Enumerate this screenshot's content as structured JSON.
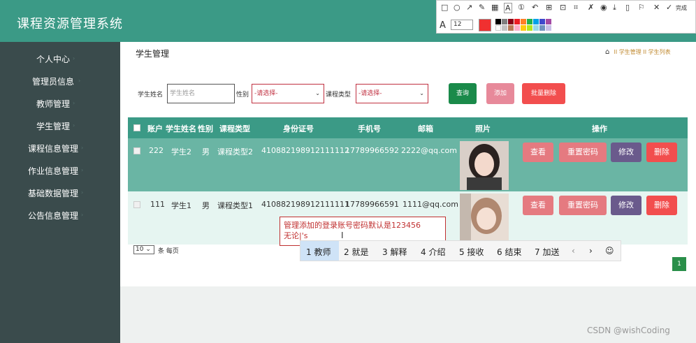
{
  "header": {
    "title": "课程资源管理系统",
    "icon1": "✖",
    "icon2": "♟"
  },
  "sidebar": {
    "items": [
      {
        "label": "个人中心"
      },
      {
        "label": "管理员信息"
      },
      {
        "label": "教师管理"
      },
      {
        "label": "学生管理"
      },
      {
        "label": "课程信息管理"
      },
      {
        "label": "作业信息管理"
      },
      {
        "label": "基础数据管理"
      },
      {
        "label": "公告信息管理"
      }
    ]
  },
  "page": {
    "title": "学生管理",
    "crumb1": "学生管理",
    "crumb2": "学生列表",
    "sep": "II"
  },
  "filters": {
    "name_label": "学生姓名",
    "name_placeholder": "学生姓名",
    "gender_label": "性别",
    "gender_value": "-请选择-",
    "type_label": "课程类型",
    "type_value": "-请选择-"
  },
  "buttons": {
    "search": "查询",
    "add": "添加",
    "batch_delete": "批量删除"
  },
  "table": {
    "headers": [
      "账户",
      "学生姓名",
      "性别",
      "课程类型",
      "身份证号",
      "手机号",
      "邮箱",
      "照片",
      "操作"
    ],
    "rows": [
      {
        "account": "222",
        "name": "学生2",
        "gender": "男",
        "type": "课程类型2",
        "id": "410882198912111112",
        "phone": "17789966592",
        "email": "2222@qq.com"
      },
      {
        "account": "111",
        "name": "学生1",
        "gender": "男",
        "type": "课程类型1",
        "id": "410882198912111111",
        "phone": "17789966591",
        "email": "1111@qq.com"
      }
    ],
    "actions": {
      "view": "查看",
      "reset": "重置密码",
      "edit": "修改",
      "delete": "删除"
    }
  },
  "pagination": {
    "per_page": "10",
    "per_page_label": "条 每页",
    "current": "1"
  },
  "tooltip": {
    "line1": "管理添加的登录账号密码默认是123456",
    "line2": "无论|'s"
  },
  "ime": {
    "candidates": [
      "1 教师",
      "2 就是",
      "3 解释",
      "4 介绍",
      "5 接收",
      "6 结束",
      "7 加送"
    ]
  },
  "toolbar": {
    "font_letter": "A",
    "font_size": "12",
    "done": "完成"
  },
  "watermark": "CSDN @wishCoding",
  "colors": {
    "accent": "#3b9a86",
    "sidebar": "#3a4b4c",
    "danger": "#f24e4e",
    "purple": "#6a5a8c",
    "pink": "#e57a80"
  }
}
